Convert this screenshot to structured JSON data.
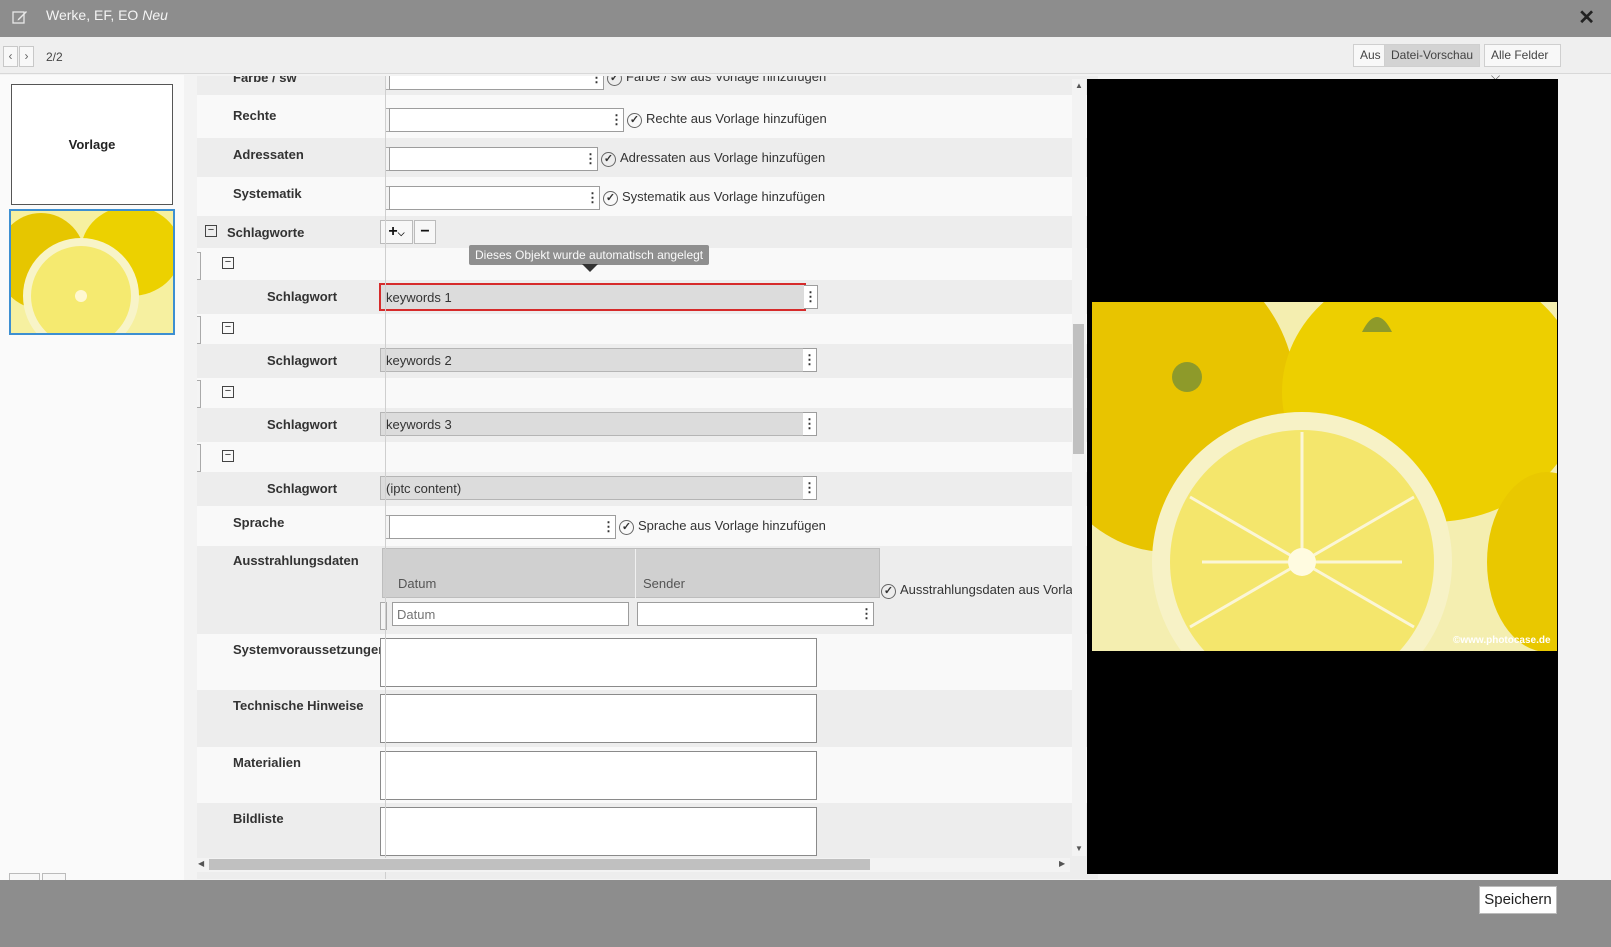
{
  "window": {
    "title": "Werke, EF, EO",
    "title_suffix": "Neu"
  },
  "nav": {
    "counter": "2/2",
    "prev": "‹",
    "next": "›"
  },
  "view": {
    "off_label": "Aus",
    "preview_label": "Datei-Vorschau",
    "fields_label": "Alle Felder"
  },
  "left": {
    "template_label": "Vorlage"
  },
  "tooltip": "Dieses Objekt wurde automatisch angelegt",
  "fields": {
    "farbe": {
      "label": "Farbe / sw",
      "check": "Farbe / sw aus Vorlage hinzufügen"
    },
    "rechte": {
      "label": "Rechte",
      "check": "Rechte aus Vorlage hinzufügen"
    },
    "adressaten": {
      "label": "Adressaten",
      "check": "Adressaten aus Vorlage hinzufügen"
    },
    "systematik": {
      "label": "Systematik",
      "check": "Systematik aus Vorlage hinzufügen"
    },
    "schlagworte": {
      "label": "Schlagworte"
    },
    "schlagwort_label": "Schlagwort",
    "keywords": [
      "keywords 1",
      "keywords 2",
      "keywords 3",
      "(iptc content)"
    ],
    "sprache": {
      "label": "Sprache",
      "check": "Sprache aus Vorlage hinzufügen"
    },
    "ausstrahlung": {
      "label": "Ausstrahlungsdaten",
      "col_datum": "Datum",
      "col_sender": "Sender",
      "placeholder_datum": "Datum",
      "check": "Ausstrahlungsdaten aus Vorlag"
    },
    "systemvoraussetzungen": "Systemvoraussetzungen",
    "technische_hinweise": "Technische Hinweise",
    "materialien": "Materialien",
    "bildliste": "Bildliste"
  },
  "preview": {
    "credit": "©www.photocase.de"
  },
  "footer": {
    "save_label": "Speichern"
  }
}
